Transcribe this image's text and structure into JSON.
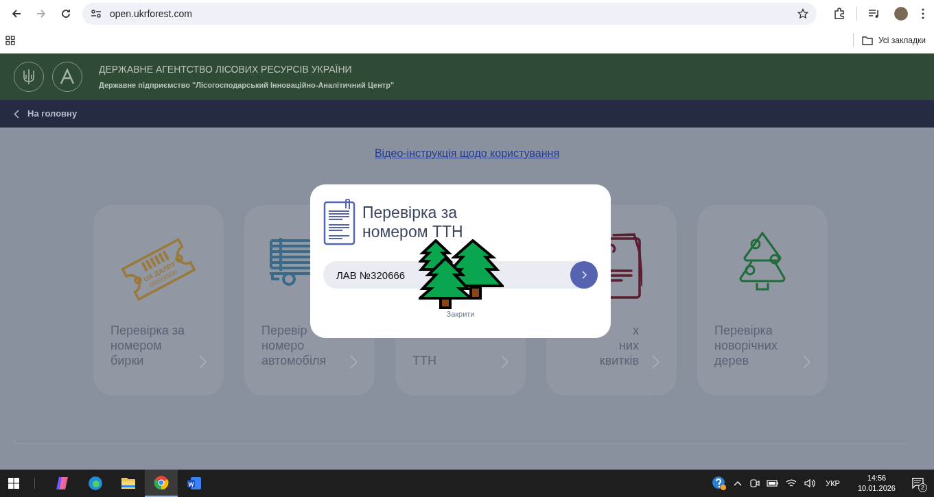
{
  "browser": {
    "url": "open.ukrforest.com",
    "bookmarks_folder": "Усі закладки"
  },
  "header": {
    "title": "ДЕРЖАВНЕ АГЕНТСТВО ЛІСОВИХ РЕСУРСІВ УКРАЇНИ",
    "subtitle": "Державне підприємство \"Лісогосподарський Інноваційно-Аналітичний Центр\""
  },
  "nav": {
    "back_label": "На головну"
  },
  "video_link": "Відео-інструкція щодо користування",
  "cards": [
    {
      "kind": "tag",
      "left_part_hidden": false,
      "icon_text": [
        "UA ДАЛРУ",
        "000000000"
      ],
      "title_lines": [
        "Перевірка за",
        "номером",
        "бирки"
      ]
    },
    {
      "kind": "truck",
      "left_part_hidden": false,
      "title_lines": [
        "Перевір",
        "номеро",
        "автомобіля"
      ]
    },
    {
      "kind": "none",
      "left_part_hidden": false,
      "title_lines": [
        "ТТН"
      ]
    },
    {
      "kind": "clipboard",
      "left_part_hidden": true,
      "title_lines": [
        "х",
        "них",
        "квитків"
      ]
    },
    {
      "kind": "tree",
      "left_part_hidden": false,
      "title_lines": [
        "Перевірка",
        "новорічних",
        "дерев"
      ]
    }
  ],
  "modal": {
    "title": "Перевірка за номером ТТН",
    "input_value": "ЛАВ №320666",
    "close_label": "Закрити"
  },
  "taskbar": {
    "apps": [
      {
        "kind": "copilot",
        "selected": false
      },
      {
        "kind": "edge",
        "selected": false
      },
      {
        "kind": "explorer",
        "selected": false
      },
      {
        "kind": "chrome",
        "selected": true
      },
      {
        "kind": "word",
        "selected": false
      }
    ],
    "language": "УКР",
    "time": "14:56",
    "date": "10.01.2026",
    "notifications": "2"
  }
}
